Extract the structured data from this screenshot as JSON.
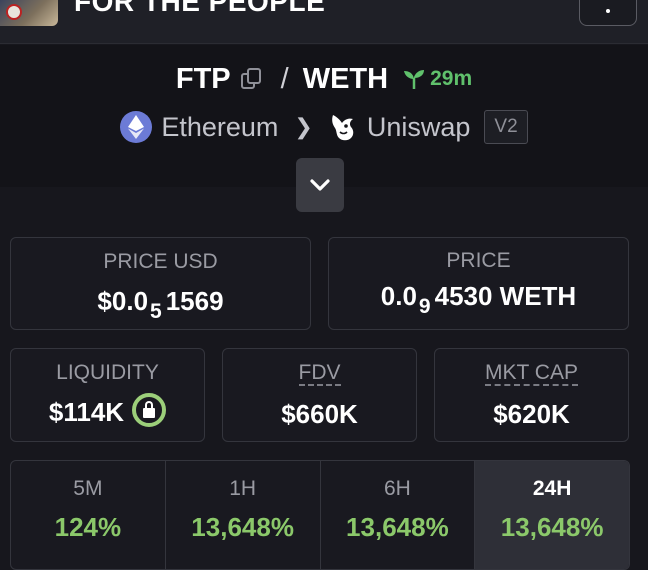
{
  "topbar": {
    "token_name": "FOR THE PEOPLE"
  },
  "pair": {
    "base": "FTP",
    "separator": "/",
    "quote": "WETH",
    "age": "29m"
  },
  "chain": {
    "network": "Ethereum",
    "dex": "Uniswap",
    "version": "V2"
  },
  "stats": {
    "price_usd": {
      "label": "PRICE USD",
      "prefix": "$0.0",
      "zeros": "5",
      "digits": "1569"
    },
    "price_native": {
      "label": "PRICE",
      "prefix": "0.0",
      "zeros": "9",
      "digits": "4530 WETH"
    },
    "liquidity": {
      "label": "LIQUIDITY",
      "value": "$114K"
    },
    "fdv": {
      "label": "FDV",
      "value": "$660K"
    },
    "mkt_cap": {
      "label": "MKT CAP",
      "value": "$620K"
    }
  },
  "timeframes": [
    {
      "label": "5M",
      "change": "124%"
    },
    {
      "label": "1H",
      "change": "13,648%"
    },
    {
      "label": "6H",
      "change": "13,648%"
    },
    {
      "label": "24H",
      "change": "13,648%"
    }
  ],
  "active_timeframe": "24H",
  "colors": {
    "positive": "#8bc86a",
    "age": "#60c16c",
    "background": "#17171d"
  }
}
